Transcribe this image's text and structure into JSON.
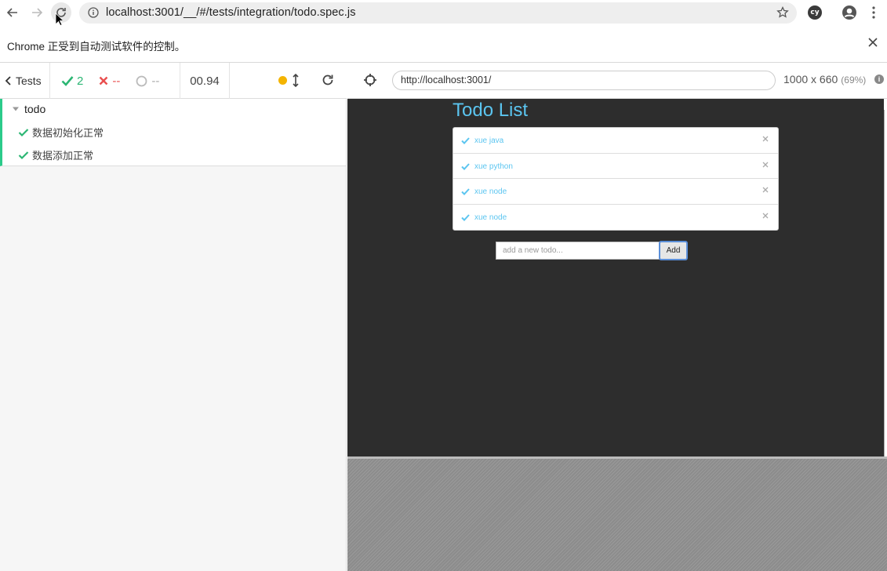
{
  "browser": {
    "url": "localhost:3001/__/#/tests/integration/todo.spec.js",
    "extension_label": "cy"
  },
  "automation_bar": {
    "message": "Chrome 正受到自动测试软件的控制。"
  },
  "runner": {
    "tests_label": "Tests",
    "passed": "2",
    "failed": "--",
    "pending": "--",
    "duration": "00.94",
    "suite": {
      "title": "todo",
      "tests": [
        "数据初始化正常",
        "数据添加正常"
      ]
    }
  },
  "preview": {
    "url": "http://localhost:3001/",
    "viewport": "1000 x 660",
    "scale": "(69%)"
  },
  "app": {
    "title": "Todo List",
    "todos": [
      "xue java",
      "xue python",
      "xue node",
      "xue node"
    ],
    "input_placeholder": "add a new todo...",
    "add_label": "Add"
  },
  "colors": {
    "pass": "#2bb673",
    "fail": "#e94f4f",
    "accent": "#5bc5f0",
    "suite_border": "#2bcb8a",
    "running_dot": "#f4b400"
  }
}
